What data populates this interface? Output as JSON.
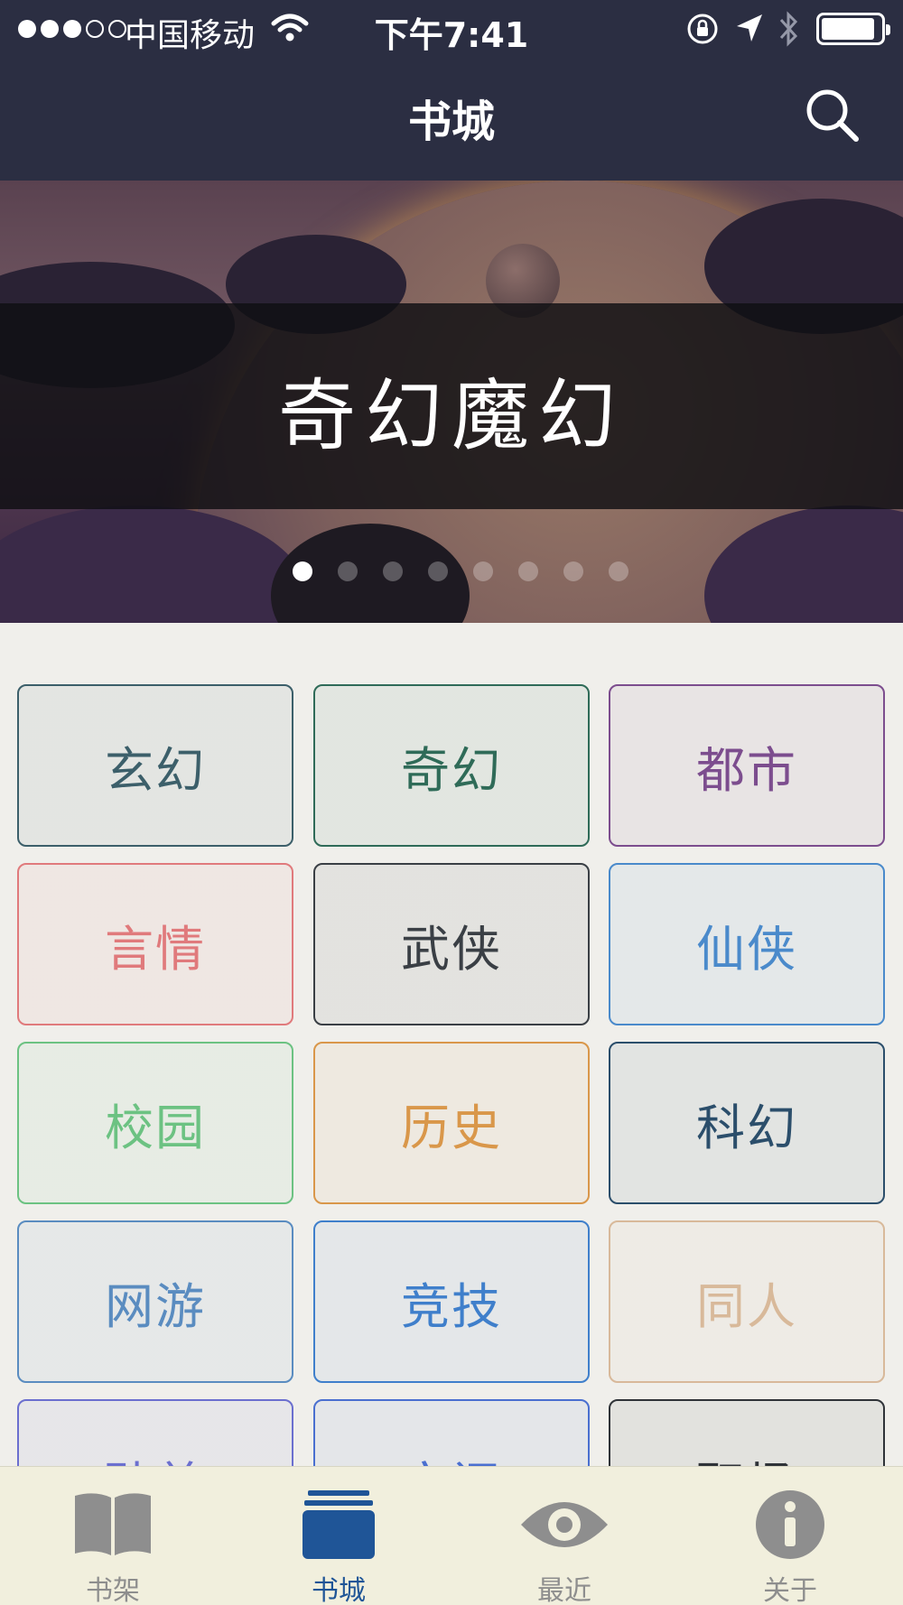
{
  "status_bar": {
    "carrier": "中国移动",
    "time": "下午7:41",
    "signal_bars_filled": 3,
    "signal_bars_total": 5,
    "battery_level": 0.9
  },
  "nav": {
    "title": "书城",
    "search_icon": "search-icon"
  },
  "banner": {
    "title": "奇幻魔幻",
    "page_count": 8,
    "active_page": 1
  },
  "categories": [
    {
      "label": "玄幻",
      "color": "#3c5f6a"
    },
    {
      "label": "奇幻",
      "color": "#2f6b58"
    },
    {
      "label": "都市",
      "color": "#7c4d8e"
    },
    {
      "label": "言情",
      "color": "#e07a7c"
    },
    {
      "label": "武侠",
      "color": "#3a3f45"
    },
    {
      "label": "仙侠",
      "color": "#4a8acb"
    },
    {
      "label": "校园",
      "color": "#6cc282"
    },
    {
      "label": "历史",
      "color": "#d9974a"
    },
    {
      "label": "科幻",
      "color": "#2b4e6b"
    },
    {
      "label": "网游",
      "color": "#5a8cc0"
    },
    {
      "label": "竞技",
      "color": "#3f7fcb"
    },
    {
      "label": "同人",
      "color": "#d8b99a"
    },
    {
      "label": "耽美",
      "color": "#6b6fcf"
    },
    {
      "label": "空间",
      "color": "#4a6fd0"
    },
    {
      "label": "职场",
      "color": "#2f3338"
    }
  ],
  "tabbar": {
    "items": [
      {
        "label": "书架",
        "icon": "open-book-icon"
      },
      {
        "label": "书城",
        "icon": "bookstore-icon"
      },
      {
        "label": "最近",
        "icon": "eye-icon"
      },
      {
        "label": "关于",
        "icon": "info-icon"
      }
    ],
    "active_index": 1,
    "active_color": "#1f5597",
    "inactive_color": "#8e8e8e"
  }
}
